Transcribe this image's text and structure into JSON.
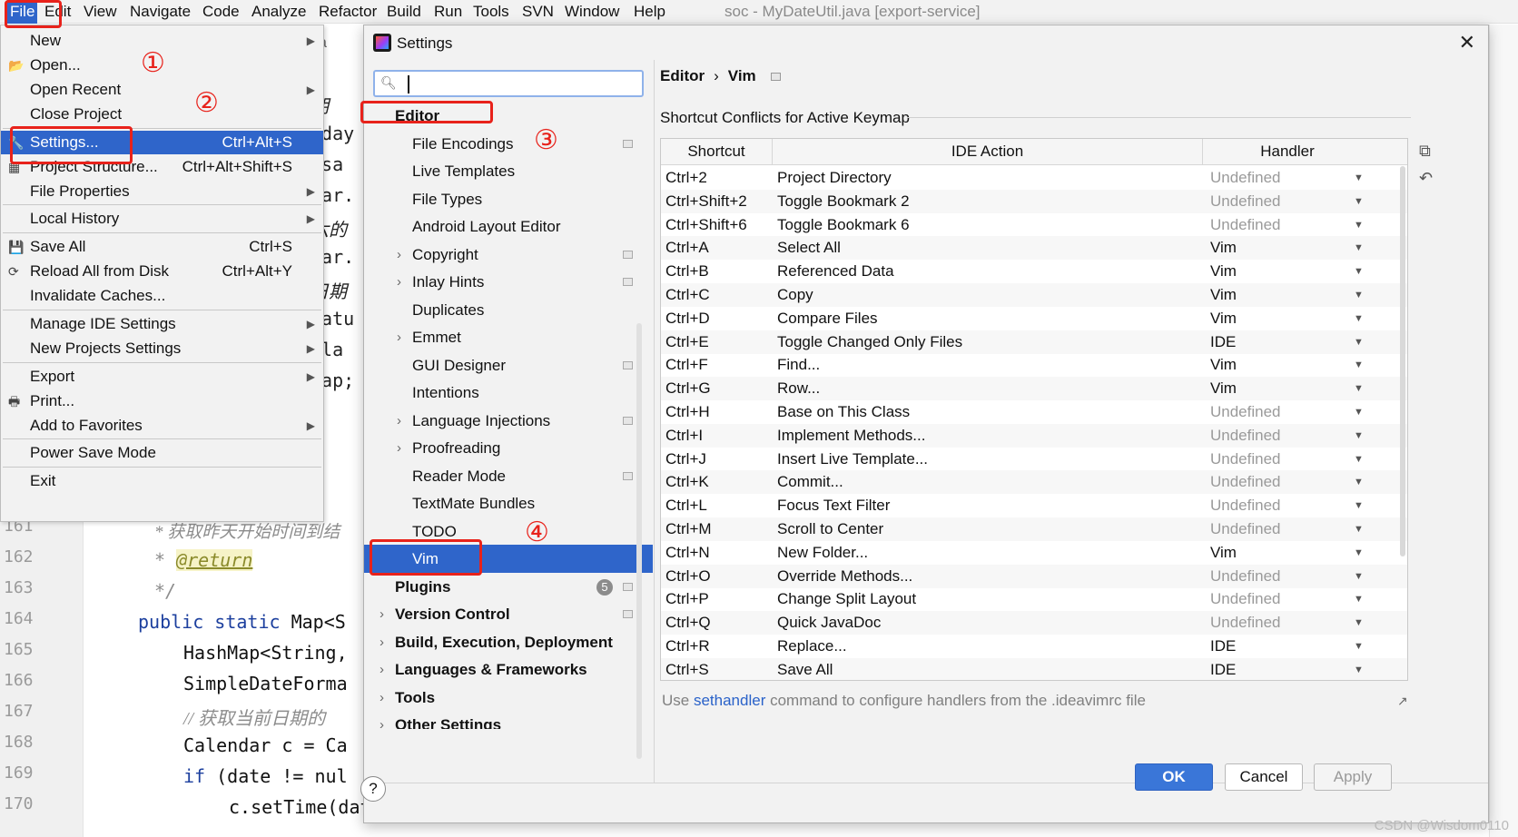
{
  "menubar": {
    "items": [
      "File",
      "Edit",
      "View",
      "Navigate",
      "Code",
      "Analyze",
      "Refactor",
      "Build",
      "Run",
      "Tools",
      "SVN",
      "Window",
      "Help"
    ],
    "window_title": "soc - MyDateUtil.java [export-service]"
  },
  "editor": {
    "fragments": [
      "va",
      "期",
      "rday",
      "\"sa",
      "dar.",
      "六的",
      "dar.",
      "日期",
      "Satu",
      "\"la",
      "Map;"
    ],
    "lines": [
      {
        "num": "161",
        "text": "* 获取昨天开始时间到结"
      },
      {
        "num": "162",
        "pre": "* ",
        "ann": "@return"
      },
      {
        "num": "163",
        "text": "*/"
      },
      {
        "num": "164",
        "kw": "public static",
        "rest": " Map<S"
      },
      {
        "num": "165",
        "text": "HashMap<String,"
      },
      {
        "num": "166",
        "text": "SimpleDateForma"
      },
      {
        "num": "167",
        "text": "// 获取当前日期的"
      },
      {
        "num": "168",
        "text": "Calendar c = Ca"
      },
      {
        "num": "169",
        "kw": "if",
        "rest": " (date != nul"
      },
      {
        "num": "170",
        "text": "c.setTime(date);"
      }
    ]
  },
  "file_menu": {
    "new": "New",
    "open": "Open...",
    "open_recent": "Open Recent",
    "close_project": "Close Project",
    "settings": "Settings...",
    "settings_sc": "Ctrl+Alt+S",
    "project_structure": "Project Structure...",
    "project_structure_sc": "Ctrl+Alt+Shift+S",
    "file_properties": "File Properties",
    "local_history": "Local History",
    "save_all": "Save All",
    "save_all_sc": "Ctrl+S",
    "reload": "Reload All from Disk",
    "reload_sc": "Ctrl+Alt+Y",
    "invalidate": "Invalidate Caches...",
    "manage_ide": "Manage IDE Settings",
    "new_projects": "New Projects Settings",
    "export": "Export",
    "print": "Print...",
    "add_favorites": "Add to Favorites",
    "power_save": "Power Save Mode",
    "exit": "Exit"
  },
  "settings": {
    "title": "Settings",
    "search_placeholder": "",
    "tree": {
      "editor": "Editor",
      "children": [
        "File Encodings",
        "Live Templates",
        "File Types",
        "Android Layout Editor",
        "Copyright",
        "Inlay Hints",
        "Duplicates",
        "Emmet",
        "GUI Designer",
        "Intentions",
        "Language Injections",
        "Proofreading",
        "Reader Mode",
        "TextMate Bundles",
        "TODO",
        "Vim"
      ],
      "plugins": "Plugins",
      "plugins_badge": "5",
      "version_control": "Version Control",
      "build": "Build, Execution, Deployment",
      "languages": "Languages & Frameworks",
      "tools": "Tools",
      "other": "Other Settings"
    },
    "breadcrumb": {
      "parent": "Editor",
      "sep": "›",
      "current": "Vim"
    },
    "section_title": "Shortcut Conflicts for Active Keymap",
    "columns": [
      "Shortcut",
      "IDE Action",
      "Handler"
    ],
    "rows": [
      [
        "Ctrl+2",
        "Project Directory",
        "Undefined"
      ],
      [
        "Ctrl+Shift+2",
        "Toggle Bookmark 2",
        "Undefined"
      ],
      [
        "Ctrl+Shift+6",
        "Toggle Bookmark 6",
        "Undefined"
      ],
      [
        "Ctrl+A",
        "Select All",
        "Vim"
      ],
      [
        "Ctrl+B",
        "Referenced Data",
        "Vim"
      ],
      [
        "Ctrl+C",
        "Copy",
        "Vim"
      ],
      [
        "Ctrl+D",
        "Compare Files",
        "Vim"
      ],
      [
        "Ctrl+E",
        "Toggle Changed Only Files",
        "IDE"
      ],
      [
        "Ctrl+F",
        "Find...",
        "Vim"
      ],
      [
        "Ctrl+G",
        "Row...",
        "Vim"
      ],
      [
        "Ctrl+H",
        "Base on This Class",
        "Undefined"
      ],
      [
        "Ctrl+I",
        "Implement Methods...",
        "Undefined"
      ],
      [
        "Ctrl+J",
        "Insert Live Template...",
        "Undefined"
      ],
      [
        "Ctrl+K",
        "Commit...",
        "Undefined"
      ],
      [
        "Ctrl+L",
        "Focus Text Filter",
        "Undefined"
      ],
      [
        "Ctrl+M",
        "Scroll to Center",
        "Undefined"
      ],
      [
        "Ctrl+N",
        "New Folder...",
        "Vim"
      ],
      [
        "Ctrl+O",
        "Override Methods...",
        "Undefined"
      ],
      [
        "Ctrl+P",
        "Change Split Layout",
        "Undefined"
      ],
      [
        "Ctrl+Q",
        "Quick JavaDoc",
        "Undefined"
      ],
      [
        "Ctrl+R",
        "Replace...",
        "IDE"
      ],
      [
        "Ctrl+S",
        "Save All",
        "IDE"
      ]
    ],
    "hint": {
      "pre": "Use ",
      "link": "sethandler",
      "post": " command to configure handlers from the .ideavimrc file"
    },
    "buttons": {
      "help": "?",
      "ok": "OK",
      "cancel": "Cancel",
      "apply": "Apply"
    }
  },
  "annotations": [
    "①",
    "②",
    "③",
    "④"
  ],
  "watermark": "CSDN @Wisdom0110",
  "colors": {
    "selection": "#2f65ca",
    "annotation": "#e8221b",
    "ok_button": "#3a76d8"
  }
}
